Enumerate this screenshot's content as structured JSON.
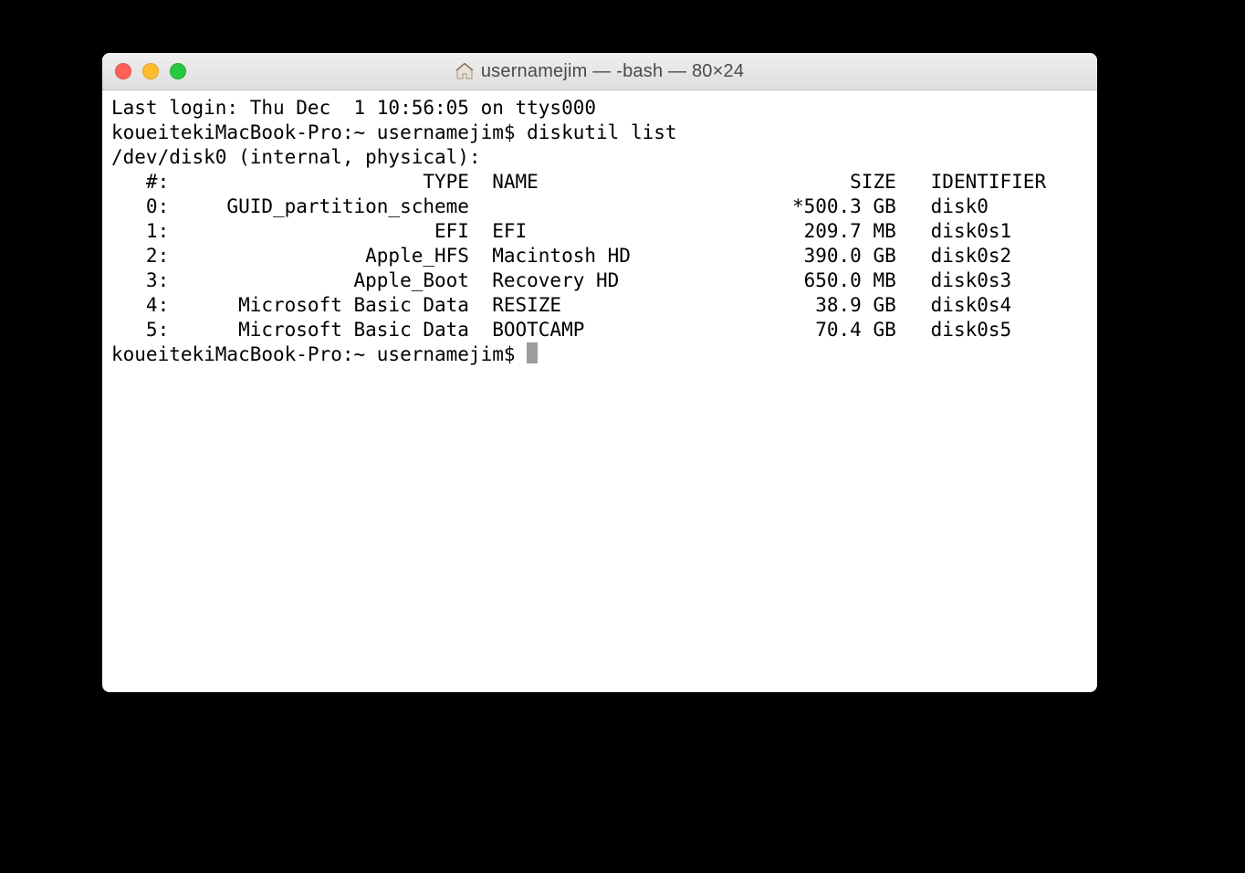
{
  "window": {
    "title": "usernamejim — -bash — 80×24"
  },
  "terminal": {
    "lastLogin": "Last login: Thu Dec  1 10:56:05 on ttys000",
    "prompt1": "koueitekiMacBook-Pro:~ usernamejim$ ",
    "command1": "diskutil list",
    "diskHeader": "/dev/disk0 (internal, physical):",
    "col": {
      "idx": "   #:",
      "type": "                      TYPE",
      "name": "NAME",
      "size": "SIZE",
      "ident": "IDENTIFIER"
    },
    "rows": [
      {
        "idx": "   0:",
        "type": "     GUID_partition_scheme",
        "name": "",
        "size": "*500.3 GB",
        "ident": "disk0"
      },
      {
        "idx": "   1:",
        "type": "                       EFI",
        "name": "EFI",
        "size": "209.7 MB",
        "ident": "disk0s1"
      },
      {
        "idx": "   2:",
        "type": "                 Apple_HFS",
        "name": "Macintosh HD",
        "size": "390.0 GB",
        "ident": "disk0s2"
      },
      {
        "idx": "   3:",
        "type": "                Apple_Boot",
        "name": "Recovery HD",
        "size": "650.0 MB",
        "ident": "disk0s3"
      },
      {
        "idx": "   4:",
        "type": "      Microsoft Basic Data",
        "name": "RESIZE",
        "size": "38.9 GB",
        "ident": "disk0s4"
      },
      {
        "idx": "   5:",
        "type": "      Microsoft Basic Data",
        "name": "BOOTCAMP",
        "size": "70.4 GB",
        "ident": "disk0s5"
      }
    ],
    "prompt2": "koueitekiMacBook-Pro:~ usernamejim$ "
  }
}
